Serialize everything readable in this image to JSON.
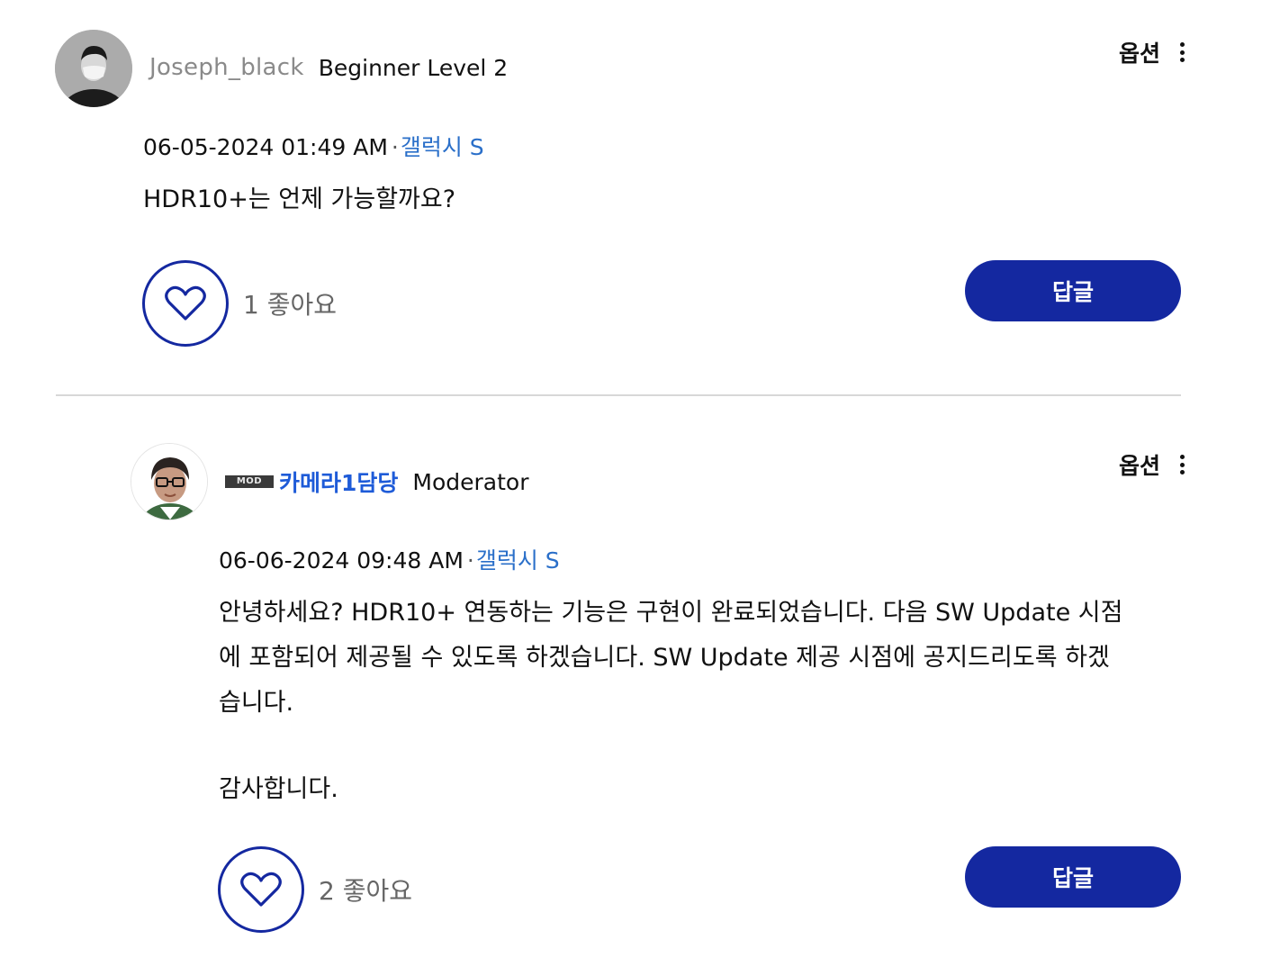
{
  "posts": [
    {
      "username": "Joseph_black",
      "rank": "Beginner Level 2",
      "options_label": "옵션",
      "datetime": "06-05-2024 01:49 AM",
      "separator": "·",
      "board": "갤럭시 S",
      "body": "HDR10+는 언제 가능할까요?",
      "like_count": "1",
      "like_label": "좋아요",
      "reply_label": "답글"
    },
    {
      "badge": "MOD",
      "username": "카메라1담당",
      "rank": "Moderator",
      "options_label": "옵션",
      "datetime": "06-06-2024 09:48 AM",
      "separator": "·",
      "board": "갤럭시 S",
      "body_lines": [
        "안녕하세요? HDR10+ 연동하는 기능은 구현이 완료되었습니다. 다음 SW Update 시점",
        "에 포함되어 제공될 수 있도록 하겠습니다. SW Update 제공 시점에 공지드리도록 하겠",
        "습니다."
      ],
      "body_closing": "감사합니다.",
      "like_count": "2",
      "like_label": "좋아요",
      "reply_label": "답글"
    }
  ],
  "colors": {
    "accent": "#1428a0",
    "link": "#2a6fc9",
    "username_blue": "#1e5bd8"
  },
  "icons": [
    "heart-icon",
    "kebab-menu-icon"
  ]
}
